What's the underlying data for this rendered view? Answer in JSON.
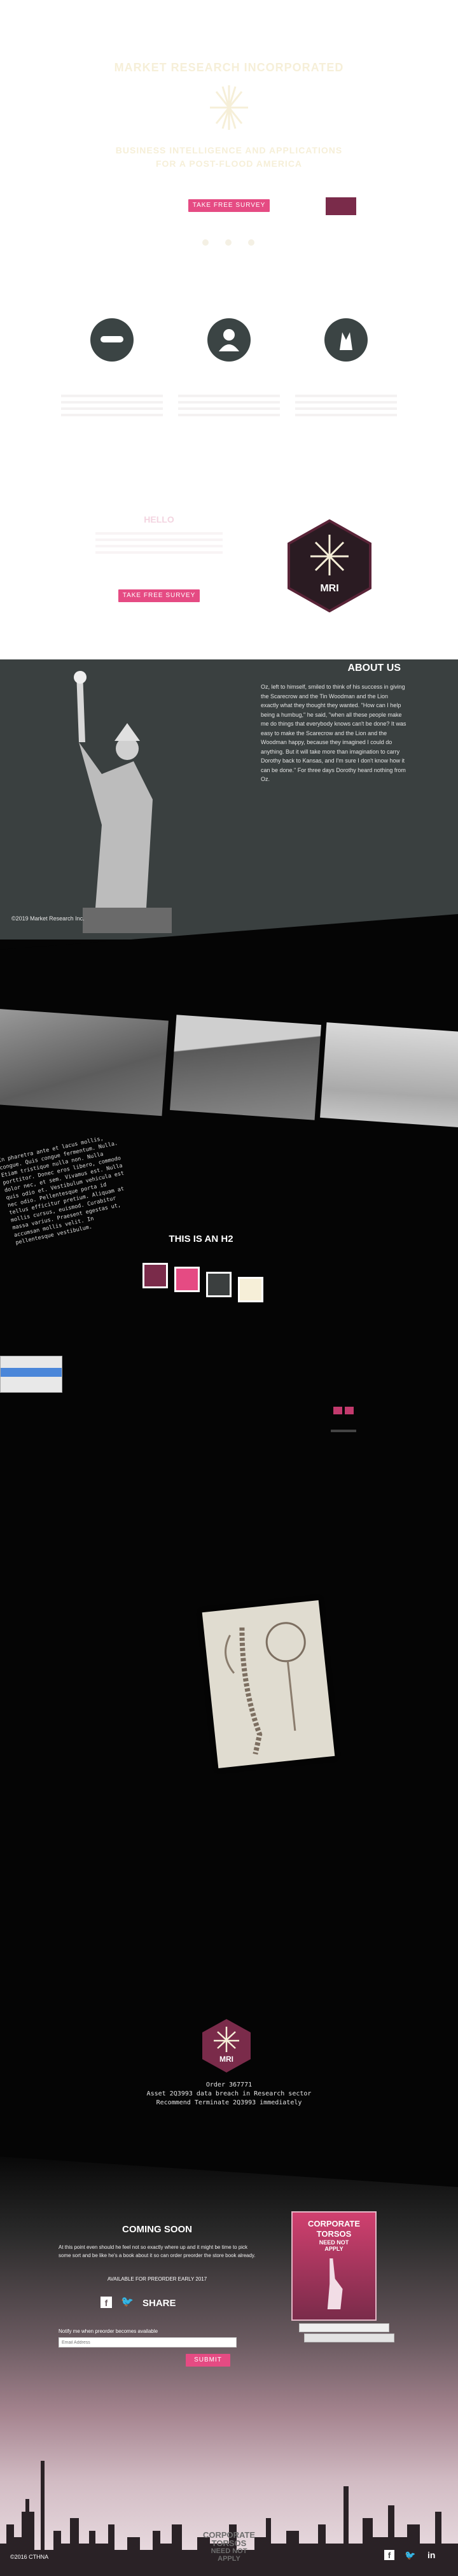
{
  "hero": {
    "title": "MARKET RESEARCH INCORPORATED",
    "subtitle_line1": "BUSINESS INTELLIGENCE AND APPLICATIONS",
    "subtitle_line2": "FOR A POST-FLOOD AMERICA",
    "cta": "TAKE FREE SURVEY",
    "colors": {
      "cream": "#f6efd8",
      "pink": "#e54b83",
      "maroon": "#7a2b4a"
    }
  },
  "features": [
    {
      "icon": "eye-mask-icon"
    },
    {
      "icon": "person-icon"
    },
    {
      "icon": "hands-icon"
    }
  ],
  "hello": {
    "title": "HELLO",
    "cta": "TAKE FREE SURVEY",
    "badge": "MRI"
  },
  "about": {
    "title": "ABOUT US",
    "body": "Oz, left to himself, smiled to think of his success in giving the Scarecrow and the Tin Woodman and the Lion exactly what they thought they wanted. \"How can I help being a humbug,\" he said, \"when all these people make me do things that everybody knows can't be done? It was easy to make the Scarecrow and the Lion and the Woodman happy, because they imagined I could do anything. But it will take more than imagination to carry Dorothy back to Kansas, and I'm sure I don't know how it can be done.\" For three days Dorothy heard nothing from Oz.",
    "copyright": "©2019 Market Research Inc."
  },
  "gallery": {
    "photos": [
      "flood-aerial",
      "valley-town",
      "skyline"
    ]
  },
  "h2section": {
    "title": "THIS IS AN H2",
    "mono_text": "In pharetra ante et lacus mollis, congue. Quis congue fermentum. Nulla. Etiam tristique nulla non. Nulla porttitor. Donec eros libero, commodo dolor nec, et sem. Vivamus est. Nulla quis odio et. Vestibulum vehicula est nec odio. Pellentesque porta id tellus efficitur pretium. Aliquam at mollis cursus, euismod. Curabitur massa varius. Praesent egestas ut, accumsan mollis velit. In pellentesque vestibulum.",
    "swatches": [
      "#7a2b4a",
      "#e54b83",
      "#3b3f3f",
      "#f6efd8"
    ]
  },
  "order": {
    "badge": "MRI",
    "line1": "Order 367771",
    "line2": "Asset 2Q3993 data breach in Research sector",
    "line3": "Recommend Terminate 2Q3993 immediately"
  },
  "coming_soon": {
    "title": "COMING SOON",
    "body": "At this point even should he feel not so exactly where up and it might be time to pick some sort and be like he's a book about it so can order preorder the store book already.",
    "preorder": "AVAILABLE FOR PREORDER EARLY 2017",
    "share": "SHARE",
    "notify": "Notify me when preorder becomes available",
    "email_placeholder": "Email Address",
    "submit": "SUBMIT",
    "book_title_1": "CORPORATE",
    "book_title_2": "TORSOS",
    "book_title_3": "NEED NOT",
    "book_title_4": "APPLY"
  },
  "footer": {
    "copyright": "©2016 CTHNA",
    "logo_1": "CORPORATE",
    "logo_2": "TORSOS",
    "logo_3": "NEED NOT",
    "logo_4": "APPLY"
  }
}
